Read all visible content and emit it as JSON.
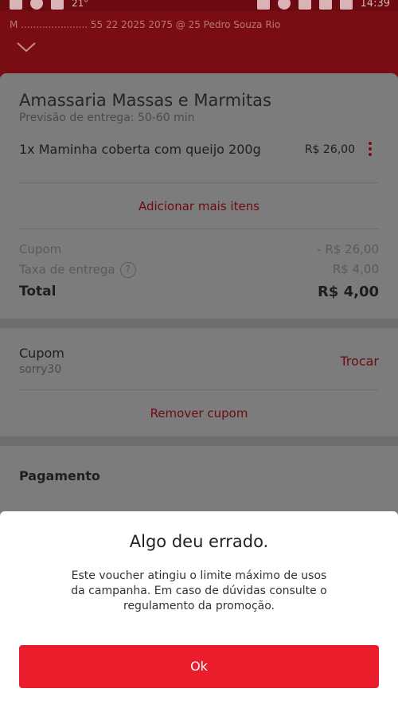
{
  "statusbar": {
    "temperature": "21°",
    "time": "14:39"
  },
  "header": {
    "notification_line": "M ...................... 55 22 2025 2075 @ 25 Pedro Souza Rio"
  },
  "restaurant": {
    "name": "Amassaria Massas e  Marmitas",
    "eta": "Previsão de entrega: 50-60 min"
  },
  "order_item": {
    "name": "1x  Maminha coberta com queijo 200g",
    "price": "R$ 26,00"
  },
  "add_more_label": "Adicionar mais itens",
  "totals": {
    "coupon_label": "Cupom",
    "coupon_value": "- R$ 26,00",
    "delivery_label": "Taxa de entrega",
    "delivery_value": "R$ 4,00",
    "total_label": "Total",
    "total_value": "R$ 4,00"
  },
  "coupon": {
    "title": "Cupom",
    "code": "sorry30",
    "swap_label": "Trocar",
    "remove_label": "Remover cupom"
  },
  "payment": {
    "title": "Pagamento"
  },
  "dialog": {
    "title": "Algo deu errado.",
    "message": "Este voucher atingiu o limite máximo de usos da campanha. Em caso de dúvidas consulte o regulamento da promoção.",
    "ok_label": "Ok"
  },
  "colors": {
    "brand_red": "#ea1d2c",
    "dimmed_red": "#7a0d13"
  }
}
